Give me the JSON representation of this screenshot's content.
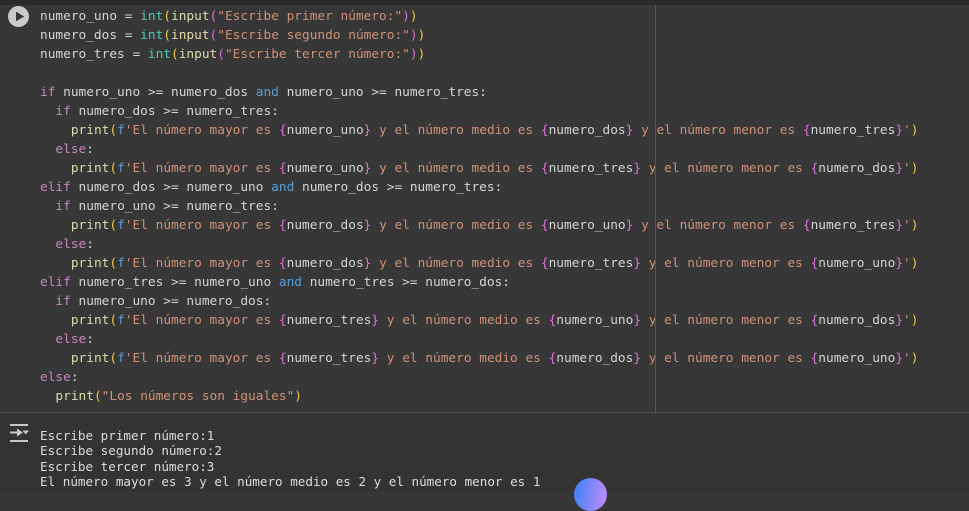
{
  "colors": {
    "editor_bg": "#373737",
    "strip_bg": "#2b2b2b",
    "output_bg": "#333333",
    "separator": "#4d4d4d",
    "ruler": "#565656",
    "output_text": "#dcdcdc",
    "play_circle": "#cbcbcb",
    "play_triangle": "#373737",
    "output_icon": "#c8c8c8",
    "fab_gradient_start": "#4d82f6",
    "fab_gradient_end": "#b18bf9"
  },
  "syntax_colors": {
    "v": "#d4d4d4",
    "k": "#c586c0",
    "kb": "#569cd6",
    "ty": "#4ec9b0",
    "fn": "#dcdcaa",
    "str": "#ce9178",
    "p1": "#ecc842",
    "p2": "#da70d6"
  },
  "icons": {
    "run": "play-circle-icon",
    "output": "output-redirect-icon",
    "fab": "gradient-orb"
  },
  "editor": {
    "ruler_column": 80,
    "code_lines": [
      [
        {
          "t": "numero_uno = ",
          "s": "v"
        },
        {
          "t": "int",
          "s": "ty"
        },
        {
          "t": "(",
          "s": "p1"
        },
        {
          "t": "input",
          "s": "fn"
        },
        {
          "t": "(",
          "s": "p2"
        },
        {
          "t": "\"Escribe primer número:\"",
          "s": "str"
        },
        {
          "t": ")",
          "s": "p2"
        },
        {
          "t": ")",
          "s": "p1"
        }
      ],
      [
        {
          "t": "numero_dos = ",
          "s": "v"
        },
        {
          "t": "int",
          "s": "ty"
        },
        {
          "t": "(",
          "s": "p1"
        },
        {
          "t": "input",
          "s": "fn"
        },
        {
          "t": "(",
          "s": "p2"
        },
        {
          "t": "\"Escribe segundo número:\"",
          "s": "str"
        },
        {
          "t": ")",
          "s": "p2"
        },
        {
          "t": ")",
          "s": "p1"
        }
      ],
      [
        {
          "t": "numero_tres = ",
          "s": "v"
        },
        {
          "t": "int",
          "s": "ty"
        },
        {
          "t": "(",
          "s": "p1"
        },
        {
          "t": "input",
          "s": "fn"
        },
        {
          "t": "(",
          "s": "p2"
        },
        {
          "t": "\"Escribe tercer número:\"",
          "s": "str"
        },
        {
          "t": ")",
          "s": "p2"
        },
        {
          "t": ")",
          "s": "p1"
        }
      ],
      [],
      [
        {
          "t": "if",
          "s": "k"
        },
        {
          "t": " numero_uno >= numero_dos ",
          "s": "v"
        },
        {
          "t": "and",
          "s": "kb"
        },
        {
          "t": " numero_uno >= numero_tres:",
          "s": "v"
        }
      ],
      [
        {
          "t": "  ",
          "s": "v"
        },
        {
          "t": "if",
          "s": "k"
        },
        {
          "t": " numero_dos >= numero_tres:",
          "s": "v"
        }
      ],
      [
        {
          "t": "    ",
          "s": "v"
        },
        {
          "t": "print",
          "s": "fn"
        },
        {
          "t": "(",
          "s": "p1"
        },
        {
          "t": "f",
          "s": "kb"
        },
        {
          "t": "'El número mayor es ",
          "s": "str"
        },
        {
          "t": "{",
          "s": "p2"
        },
        {
          "t": "numero_uno",
          "s": "v"
        },
        {
          "t": "}",
          "s": "p2"
        },
        {
          "t": " y el número medio es ",
          "s": "str"
        },
        {
          "t": "{",
          "s": "p2"
        },
        {
          "t": "numero_dos",
          "s": "v"
        },
        {
          "t": "}",
          "s": "p2"
        },
        {
          "t": " y el número menor es ",
          "s": "str"
        },
        {
          "t": "{",
          "s": "p2"
        },
        {
          "t": "numero_tres",
          "s": "v"
        },
        {
          "t": "}",
          "s": "p2"
        },
        {
          "t": "'",
          "s": "str"
        },
        {
          "t": ")",
          "s": "p1"
        }
      ],
      [
        {
          "t": "  ",
          "s": "v"
        },
        {
          "t": "else",
          "s": "k"
        },
        {
          "t": ":",
          "s": "v"
        }
      ],
      [
        {
          "t": "    ",
          "s": "v"
        },
        {
          "t": "print",
          "s": "fn"
        },
        {
          "t": "(",
          "s": "p1"
        },
        {
          "t": "f",
          "s": "kb"
        },
        {
          "t": "'El número mayor es ",
          "s": "str"
        },
        {
          "t": "{",
          "s": "p2"
        },
        {
          "t": "numero_uno",
          "s": "v"
        },
        {
          "t": "}",
          "s": "p2"
        },
        {
          "t": " y el número medio es ",
          "s": "str"
        },
        {
          "t": "{",
          "s": "p2"
        },
        {
          "t": "numero_tres",
          "s": "v"
        },
        {
          "t": "}",
          "s": "p2"
        },
        {
          "t": " y el número menor es ",
          "s": "str"
        },
        {
          "t": "{",
          "s": "p2"
        },
        {
          "t": "numero_dos",
          "s": "v"
        },
        {
          "t": "}",
          "s": "p2"
        },
        {
          "t": "'",
          "s": "str"
        },
        {
          "t": ")",
          "s": "p1"
        }
      ],
      [
        {
          "t": "elif",
          "s": "k"
        },
        {
          "t": " numero_dos >= numero_uno ",
          "s": "v"
        },
        {
          "t": "and",
          "s": "kb"
        },
        {
          "t": " numero_dos >= numero_tres:",
          "s": "v"
        }
      ],
      [
        {
          "t": "  ",
          "s": "v"
        },
        {
          "t": "if",
          "s": "k"
        },
        {
          "t": " numero_uno >= numero_tres:",
          "s": "v"
        }
      ],
      [
        {
          "t": "    ",
          "s": "v"
        },
        {
          "t": "print",
          "s": "fn"
        },
        {
          "t": "(",
          "s": "p1"
        },
        {
          "t": "f",
          "s": "kb"
        },
        {
          "t": "'El número mayor es ",
          "s": "str"
        },
        {
          "t": "{",
          "s": "p2"
        },
        {
          "t": "numero_dos",
          "s": "v"
        },
        {
          "t": "}",
          "s": "p2"
        },
        {
          "t": " y el número medio es ",
          "s": "str"
        },
        {
          "t": "{",
          "s": "p2"
        },
        {
          "t": "numero_uno",
          "s": "v"
        },
        {
          "t": "}",
          "s": "p2"
        },
        {
          "t": " y el número menor es ",
          "s": "str"
        },
        {
          "t": "{",
          "s": "p2"
        },
        {
          "t": "numero_tres",
          "s": "v"
        },
        {
          "t": "}",
          "s": "p2"
        },
        {
          "t": "'",
          "s": "str"
        },
        {
          "t": ")",
          "s": "p1"
        }
      ],
      [
        {
          "t": "  ",
          "s": "v"
        },
        {
          "t": "else",
          "s": "k"
        },
        {
          "t": ":",
          "s": "v"
        }
      ],
      [
        {
          "t": "    ",
          "s": "v"
        },
        {
          "t": "print",
          "s": "fn"
        },
        {
          "t": "(",
          "s": "p1"
        },
        {
          "t": "f",
          "s": "kb"
        },
        {
          "t": "'El número mayor es ",
          "s": "str"
        },
        {
          "t": "{",
          "s": "p2"
        },
        {
          "t": "numero_dos",
          "s": "v"
        },
        {
          "t": "}",
          "s": "p2"
        },
        {
          "t": " y el número medio es ",
          "s": "str"
        },
        {
          "t": "{",
          "s": "p2"
        },
        {
          "t": "numero_tres",
          "s": "v"
        },
        {
          "t": "}",
          "s": "p2"
        },
        {
          "t": " y el número menor es ",
          "s": "str"
        },
        {
          "t": "{",
          "s": "p2"
        },
        {
          "t": "numero_uno",
          "s": "v"
        },
        {
          "t": "}",
          "s": "p2"
        },
        {
          "t": "'",
          "s": "str"
        },
        {
          "t": ")",
          "s": "p1"
        }
      ],
      [
        {
          "t": "elif",
          "s": "k"
        },
        {
          "t": " numero_tres >= numero_uno ",
          "s": "v"
        },
        {
          "t": "and",
          "s": "kb"
        },
        {
          "t": " numero_tres >= numero_dos:",
          "s": "v"
        }
      ],
      [
        {
          "t": "  ",
          "s": "v"
        },
        {
          "t": "if",
          "s": "k"
        },
        {
          "t": " numero_uno >= numero_dos:",
          "s": "v"
        }
      ],
      [
        {
          "t": "    ",
          "s": "v"
        },
        {
          "t": "print",
          "s": "fn"
        },
        {
          "t": "(",
          "s": "p1"
        },
        {
          "t": "f",
          "s": "kb"
        },
        {
          "t": "'El número mayor es ",
          "s": "str"
        },
        {
          "t": "{",
          "s": "p2"
        },
        {
          "t": "numero_tres",
          "s": "v"
        },
        {
          "t": "}",
          "s": "p2"
        },
        {
          "t": " y el número medio es ",
          "s": "str"
        },
        {
          "t": "{",
          "s": "p2"
        },
        {
          "t": "numero_uno",
          "s": "v"
        },
        {
          "t": "}",
          "s": "p2"
        },
        {
          "t": " y el número menor es ",
          "s": "str"
        },
        {
          "t": "{",
          "s": "p2"
        },
        {
          "t": "numero_dos",
          "s": "v"
        },
        {
          "t": "}",
          "s": "p2"
        },
        {
          "t": "'",
          "s": "str"
        },
        {
          "t": ")",
          "s": "p1"
        }
      ],
      [
        {
          "t": "  ",
          "s": "v"
        },
        {
          "t": "else",
          "s": "k"
        },
        {
          "t": ":",
          "s": "v"
        }
      ],
      [
        {
          "t": "    ",
          "s": "v"
        },
        {
          "t": "print",
          "s": "fn"
        },
        {
          "t": "(",
          "s": "p1"
        },
        {
          "t": "f",
          "s": "kb"
        },
        {
          "t": "'El número mayor es ",
          "s": "str"
        },
        {
          "t": "{",
          "s": "p2"
        },
        {
          "t": "numero_tres",
          "s": "v"
        },
        {
          "t": "}",
          "s": "p2"
        },
        {
          "t": " y el número medio es ",
          "s": "str"
        },
        {
          "t": "{",
          "s": "p2"
        },
        {
          "t": "numero_dos",
          "s": "v"
        },
        {
          "t": "}",
          "s": "p2"
        },
        {
          "t": " y el número menor es ",
          "s": "str"
        },
        {
          "t": "{",
          "s": "p2"
        },
        {
          "t": "numero_uno",
          "s": "v"
        },
        {
          "t": "}",
          "s": "p2"
        },
        {
          "t": "'",
          "s": "str"
        },
        {
          "t": ")",
          "s": "p1"
        }
      ],
      [
        {
          "t": "else",
          "s": "k"
        },
        {
          "t": ":",
          "s": "v"
        }
      ],
      [
        {
          "t": "  ",
          "s": "v"
        },
        {
          "t": "print",
          "s": "fn"
        },
        {
          "t": "(",
          "s": "p1"
        },
        {
          "t": "\"Los números son iguales\"",
          "s": "str"
        },
        {
          "t": ")",
          "s": "p1"
        }
      ]
    ]
  },
  "output": {
    "lines": [
      "Escribe primer número:1",
      "Escribe segundo número:2",
      "Escribe tercer número:3",
      "El número mayor es 3 y el número medio es 2 y el número menor es 1"
    ]
  }
}
